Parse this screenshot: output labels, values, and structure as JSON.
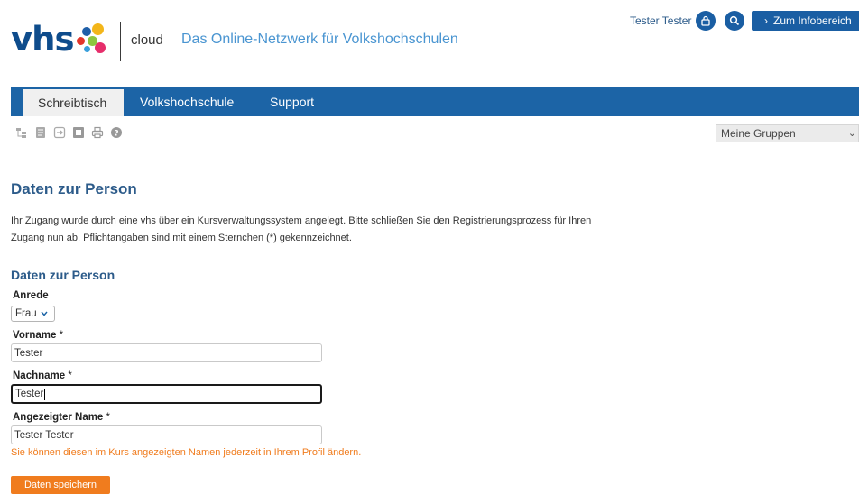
{
  "header": {
    "logo_text": "vhs",
    "cloud": "cloud",
    "tagline": "Das Online-Netzwerk für Volkshochschulen",
    "user_name": "Tester Tester",
    "info_button": "Zum Infobereich"
  },
  "nav": {
    "tabs": [
      {
        "label": "Schreibtisch"
      },
      {
        "label": "Volkshochschule"
      },
      {
        "label": "Support"
      }
    ]
  },
  "toolbar": {
    "icons": [
      "tree-icon",
      "document-icon",
      "export-icon",
      "note-icon",
      "print-icon",
      "help-icon"
    ],
    "groups_select": "Meine Gruppen"
  },
  "main": {
    "title": "Daten zur Person",
    "intro_line1": "Ihr Zugang wurde durch eine vhs über ein Kursverwaltungssystem angelegt. Bitte schließen Sie den Registrierungsprozess für Ihren",
    "intro_line2": "Zugang nun ab. Pflichtangaben sind mit einem Sternchen (*) gekennzeichnet.",
    "section_title": "Daten zur Person",
    "salutation_label": "Anrede",
    "salutation_value": "Frau",
    "firstname_label": "Vorname",
    "firstname_value": "Tester",
    "lastname_label": "Nachname",
    "lastname_value": "Tester",
    "displayname_label": "Angezeigter Name",
    "displayname_value": "Tester Tester",
    "required_mark": "*",
    "hint": "Sie können diesen im Kurs angezeigten Namen jederzeit in Ihrem Profil ändern.",
    "save_button": "Daten speichern"
  },
  "colors": {
    "brand_blue": "#1c64a6",
    "title_blue": "#2c5b8a",
    "accent_orange": "#f07c1e"
  }
}
